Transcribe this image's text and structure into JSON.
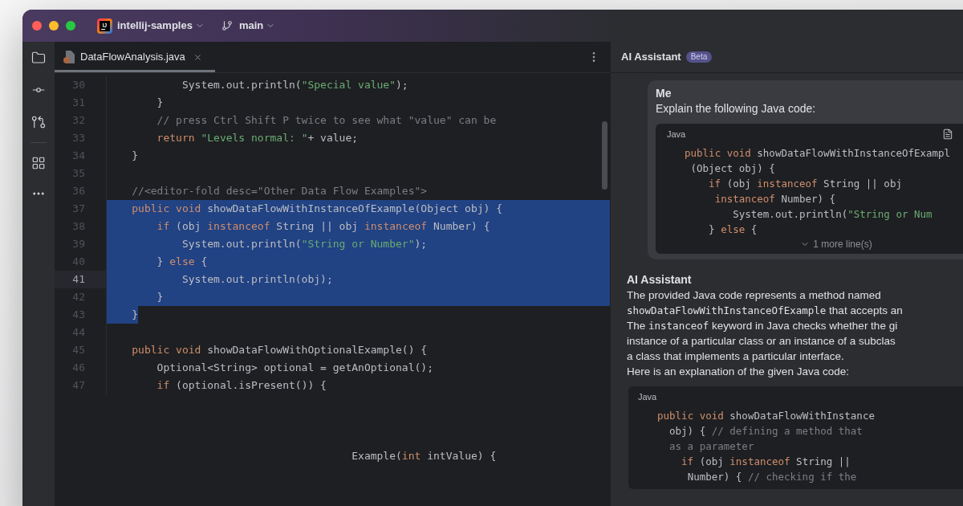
{
  "title_bar": {
    "logo_text": "IJ",
    "project": "intellij-samples",
    "branch": "main"
  },
  "editor": {
    "tabs": [
      {
        "label": "DataFlowAnalysis.java",
        "selected": true
      }
    ],
    "lines": [
      {
        "number": "30",
        "current": false,
        "selected": false,
        "tokens": [
          {
            "kind": "plain",
            "text": "            System.out.println("
          },
          {
            "kind": "string",
            "text": "\"Special value\""
          },
          {
            "kind": "plain",
            "text": ");"
          }
        ]
      },
      {
        "number": "31",
        "current": false,
        "selected": false,
        "tokens": [
          {
            "kind": "plain",
            "text": "        }"
          }
        ]
      },
      {
        "number": "32",
        "current": false,
        "selected": false,
        "tokens": [
          {
            "kind": "comment",
            "text": "        // press Ctrl Shift P twice to see what \"value\" can be"
          }
        ]
      },
      {
        "number": "33",
        "current": false,
        "selected": false,
        "tokens": [
          {
            "kind": "keyword",
            "text": "        return "
          },
          {
            "kind": "string",
            "text": "\"Levels normal: \""
          },
          {
            "kind": "plain",
            "text": "+ value;"
          }
        ]
      },
      {
        "number": "34",
        "current": false,
        "selected": false,
        "tokens": [
          {
            "kind": "plain",
            "text": "    }"
          }
        ]
      },
      {
        "number": "35",
        "current": false,
        "selected": false
      },
      {
        "number": "36",
        "current": false,
        "selected": false,
        "tokens": [
          {
            "kind": "comment",
            "text": "    //<editor-fold desc=\"Other Data Flow Examples\">"
          }
        ]
      },
      {
        "number": "37",
        "current": false,
        "selected": true,
        "tokens": [
          {
            "kind": "keyword",
            "text": "    public void"
          },
          {
            "kind": "plain",
            "text": " showDataFlowWithInstanceOfExample(Object obj) {"
          }
        ]
      },
      {
        "number": "38",
        "current": false,
        "selected": true,
        "tokens": [
          {
            "kind": "keyword",
            "text": "        if"
          },
          {
            "kind": "plain",
            "text": " (obj "
          },
          {
            "kind": "keyword",
            "text": "instanceof"
          },
          {
            "kind": "plain",
            "text": " String || obj "
          },
          {
            "kind": "keyword",
            "text": "instanceof"
          },
          {
            "kind": "plain",
            "text": " Number) {"
          }
        ]
      },
      {
        "number": "39",
        "current": false,
        "selected": true,
        "tokens": [
          {
            "kind": "plain",
            "text": "            System.out.println("
          },
          {
            "kind": "string",
            "text": "\"String or Number\""
          },
          {
            "kind": "plain",
            "text": ");"
          }
        ]
      },
      {
        "number": "40",
        "current": false,
        "selected": true,
        "tokens": [
          {
            "kind": "plain",
            "text": "        } "
          },
          {
            "kind": "keyword",
            "text": "else"
          },
          {
            "kind": "plain",
            "text": " {"
          }
        ]
      },
      {
        "number": "41",
        "current": true,
        "selected": true,
        "tokens": [
          {
            "kind": "plain",
            "text": "            System.out.println(obj);"
          }
        ]
      },
      {
        "number": "42",
        "current": false,
        "selected": true,
        "tokens": [
          {
            "kind": "plain",
            "text": "        }"
          }
        ]
      },
      {
        "number": "43",
        "current": false,
        "selected": true,
        "tokens": [
          {
            "kind": "plain",
            "text": "    }"
          }
        ]
      },
      {
        "number": "44",
        "current": false,
        "selected": false
      },
      {
        "number": "45",
        "current": false,
        "selected": false,
        "tokens": [
          {
            "kind": "keyword",
            "text": "    public void"
          },
          {
            "kind": "plain",
            "text": " showDataFlowWithOptionalExample() {"
          }
        ]
      },
      {
        "number": "46",
        "current": false,
        "selected": false,
        "tokens": [
          {
            "kind": "plain",
            "text": "        Optional<String> optional = getAnOptional();"
          }
        ]
      },
      {
        "number": "47",
        "current": false,
        "selected": false,
        "tokens": [
          {
            "kind": "keyword",
            "text": "        if"
          },
          {
            "kind": "plain",
            "text": " (optional.isPresent()) {"
          }
        ]
      }
    ],
    "cut_off_line": {
      "tokens": [
        {
          "kind": "plain",
          "text": "Example("
        },
        {
          "kind": "keyword",
          "text": "int"
        },
        {
          "kind": "plain",
          "text": " intValue) {"
        }
      ]
    }
  },
  "assistant": {
    "title": "AI Assistant",
    "badge": "Beta",
    "messages": [
      {
        "kind": "user",
        "author": "Me",
        "text": "Explain the following Java code:",
        "code": {
          "language": "Java",
          "lines": [
            {
              "tokens": [
                {
                  "kind": "keyword",
                  "text": "public void"
                },
                {
                  "kind": "plain",
                  "text": " showDataFlowWithInstanceOfExampl"
                }
              ]
            },
            {
              "tokens": [
                {
                  "kind": "plain",
                  "text": " (Object obj) {"
                }
              ]
            },
            {
              "tokens": [
                {
                  "kind": "keyword",
                  "text": "    if"
                },
                {
                  "kind": "plain",
                  "text": " (obj "
                },
                {
                  "kind": "keyword",
                  "text": "instanceof"
                },
                {
                  "kind": "plain",
                  "text": " String || obj"
                }
              ]
            },
            {
              "tokens": [
                {
                  "kind": "keyword",
                  "text": "     instanceof"
                },
                {
                  "kind": "plain",
                  "text": " Number) {"
                }
              ]
            },
            {
              "tokens": [
                {
                  "kind": "plain",
                  "text": "        System.out.println("
                },
                {
                  "kind": "string",
                  "text": "\"String or Num"
                }
              ]
            },
            {
              "tokens": [
                {
                  "kind": "plain",
                  "text": "    } "
                },
                {
                  "kind": "keyword",
                  "text": "else"
                },
                {
                  "kind": "plain",
                  "text": " {"
                }
              ]
            }
          ],
          "more": "1 more line(s)"
        }
      },
      {
        "kind": "assistant",
        "author": "AI Assistant",
        "lines": [
          {
            "segments": [
              {
                "kind": "text",
                "text": "The provided Java code represents a method named"
              }
            ]
          },
          {
            "segments": [
              {
                "kind": "code",
                "text": "showDataFlowWithInstanceOfExample"
              },
              {
                "kind": "text",
                "text": " that accepts an"
              }
            ]
          },
          {
            "segments": [
              {
                "kind": "text",
                "text": "The "
              },
              {
                "kind": "code",
                "text": "instanceof"
              },
              {
                "kind": "text",
                "text": " keyword in Java checks whether the gi"
              }
            ]
          },
          {
            "segments": [
              {
                "kind": "text",
                "text": "instance of a particular class or an instance of a subclas"
              }
            ]
          },
          {
            "segments": [
              {
                "kind": "text",
                "text": "a class that implements a particular interface."
              }
            ]
          },
          {
            "segments": [
              {
                "kind": "text",
                "text": "Here is an explanation of the given Java code:"
              }
            ]
          }
        ],
        "code": {
          "language": "Java",
          "lines": [
            {
              "tokens": [
                {
                  "kind": "keyword",
                  "text": "public void"
                },
                {
                  "kind": "plain",
                  "text": " showDataFlowWithInstance"
                }
              ]
            },
            {
              "tokens": [
                {
                  "kind": "plain",
                  "text": "  obj) { "
                },
                {
                  "kind": "comment",
                  "text": "// defining a method that"
                }
              ]
            },
            {
              "tokens": [
                {
                  "kind": "comment",
                  "text": "  as a parameter"
                }
              ]
            },
            {
              "tokens": [
                {
                  "kind": "keyword",
                  "text": "    if"
                },
                {
                  "kind": "plain",
                  "text": " (obj "
                },
                {
                  "kind": "keyword",
                  "text": "instanceof"
                },
                {
                  "kind": "plain",
                  "text": " String ||"
                }
              ]
            },
            {
              "tokens": [
                {
                  "kind": "plain",
                  "text": "     Number) { "
                },
                {
                  "kind": "comment",
                  "text": "// checking if the"
                }
              ]
            }
          ]
        }
      }
    ]
  }
}
